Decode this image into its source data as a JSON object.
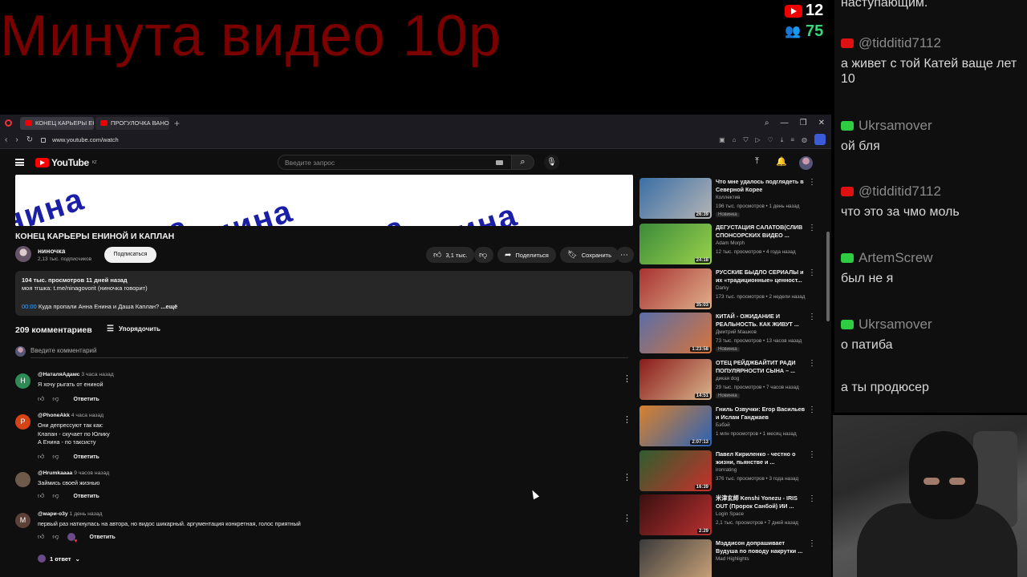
{
  "overlay": {
    "title": "Минута видео 10р",
    "views": "12",
    "viewers": "75"
  },
  "chat": {
    "messages": [
      {
        "user": "",
        "text": "наступающим.",
        "badge": "none"
      },
      {
        "user": "@tidditid7112",
        "text": "а живет с той Катей ваще лет 10",
        "badge": "yt"
      },
      {
        "user": "Ukrsamover",
        "text": "ой бля",
        "badge": "green"
      },
      {
        "user": "@tidditid7112",
        "text": "что это за чмо моль",
        "badge": "yt"
      },
      {
        "user": "ArtemScrew",
        "text": "был не я",
        "badge": "green"
      },
      {
        "user": "Ukrsamover",
        "text": "о патиба",
        "badge": "green"
      },
      {
        "user": "",
        "text": "а ты продюсер",
        "badge": "none"
      }
    ]
  },
  "browser": {
    "tabs": [
      "КОНЕЦ КАРЬЕРЫ ЕНИНОЙ",
      "ПРОГУЛОЧКА ВАНОМАС"
    ],
    "url": "www.youtube.com/watch"
  },
  "youtube": {
    "logo_text": "YouTube",
    "logo_sup": "KZ",
    "search_placeholder": "Введите запрос",
    "banner_word": "нина",
    "video": {
      "title": "КОНЕЦ КАРЬЕРЫ ЕНИНОЙ И КАПЛАН",
      "channel": "ниночка",
      "subs": "2,13 тыс. подписчиков",
      "subscribe": "Подписаться",
      "likes": "3,1 тыс.",
      "share": "Поделиться",
      "save": "Сохранить"
    },
    "description": {
      "meta": "104 тыс. просмотров  11 дней назад",
      "line2": "моя тгшка: t.me/ninagovorit (ниночка говорит)",
      "timestamp": "00:00",
      "chapter": " Куда пропали Анна Енина и Даша Каплан?",
      "more": " ...ещё"
    },
    "comments": {
      "count": "209 комментариев",
      "sort": "Упорядочить",
      "add_placeholder": "Введите комментарий",
      "reply_label": "Ответить",
      "items": [
        {
          "author": "@НаталяАдамс",
          "time": "3 часа назад",
          "lines": [
            "Я хочу рыгать от ениной"
          ],
          "avatar_letter": "Н",
          "avatar_color": "#2e8b57"
        },
        {
          "author": "@PhoneAkk",
          "time": "4 часа назад",
          "lines": [
            "Они депрессуют так как:",
            "Клапан - скучает по Юлику",
            "А Енина - по таксисту"
          ],
          "avatar_letter": "P",
          "avatar_color": "#d84315"
        },
        {
          "author": "@Hrumkaaaa",
          "time": "9 часов назад",
          "lines": [
            "Займись своей жизнью"
          ],
          "avatar_letter": "",
          "avatar_color": "#6d5a4a"
        },
        {
          "author": "@мари-о3у",
          "time": "1 день назад",
          "lines": [
            "первый раз наткнулась на автора, но видос шикарный. аргументация конкретная, голос приятный"
          ],
          "avatar_letter": "М",
          "avatar_color": "#5d4037"
        }
      ],
      "replies": "1 ответ"
    },
    "related": [
      {
        "title": "Что мне удалось подглядеть в Северной Корее",
        "channel": "Коллектив",
        "meta": "196 тыс. просмотров • 1 день назад",
        "badge": "Новинка",
        "duration": "26:39",
        "color1": "#3a6ea5",
        "color2": "#b5b5b5"
      },
      {
        "title": "ДЕГУСТАЦИЯ САЛАТОВ(СЛИВ СПОНСОРСКИХ ВИДЕО ...",
        "channel": "Adam Morph",
        "meta": "12 тыс. просмотров • 4 года назад",
        "badge": "",
        "duration": "24:18",
        "color1": "#3c8b3a",
        "color2": "#9ad14b"
      },
      {
        "title": "РУССКИЕ БЫДЛО СЕРИАЛЫ и их «традиционные» ценност...",
        "channel": "Darky",
        "meta": "173 тыс. просмотров • 2 недели назад",
        "badge": "",
        "duration": "35:03",
        "color1": "#a83232",
        "color2": "#e0b08a"
      },
      {
        "title": "КИТАЙ - ОЖИДАНИЕ И РЕАЛЬНОСТЬ. КАК ЖИВУТ ...",
        "channel": "Дмитрий Машков",
        "meta": "73 тыс. просмотров • 13 часов назад",
        "badge": "Новинка",
        "duration": "1:23:58",
        "color1": "#5a6ea8",
        "color2": "#d8743a"
      },
      {
        "title": "ОТЕЦ РЕЙДЖБАЙТИТ РАДИ ПОПУЛЯРНОСТИ СЫНА – ...",
        "channel": "дикая dog",
        "meta": "29 тыс. просмотров • 7 часов назад",
        "badge": "Новинка",
        "duration": "14:51",
        "color1": "#8a1a1a",
        "color2": "#d9b48a"
      },
      {
        "title": "Гниль Озвучки: Егор Васильев и Ислам Ганджаев",
        "channel": "Бэбэй",
        "meta": "1 млн просмотров • 1 месяц назад",
        "badge": "",
        "duration": "2:07:13",
        "color1": "#d9822b",
        "color2": "#2a62b8"
      },
      {
        "title": "Павел Кириленко - честно о жизни, пьянстве и ...",
        "channel": "ironrating",
        "meta": "376 тыс. просмотров • 3 года назад",
        "badge": "",
        "duration": "16:39",
        "color1": "#2e5e2e",
        "color2": "#c8302a"
      },
      {
        "title": "米津玄師 Kenshi Yonezu - IRIS OUT (Пророк Санбой) ИИ ...",
        "channel": "Login Space",
        "meta": "2,1 тыс. просмотров • 7 дней назад",
        "badge": "",
        "duration": "2:29",
        "color1": "#3a1010",
        "color2": "#b83030"
      },
      {
        "title": "Мэддисон допрашивает Вудуша по поводу накрутки ...",
        "channel": "Mad Highlights",
        "meta": "",
        "badge": "",
        "duration": "",
        "color1": "#3a3a3a",
        "color2": "#c9a27a"
      }
    ]
  }
}
